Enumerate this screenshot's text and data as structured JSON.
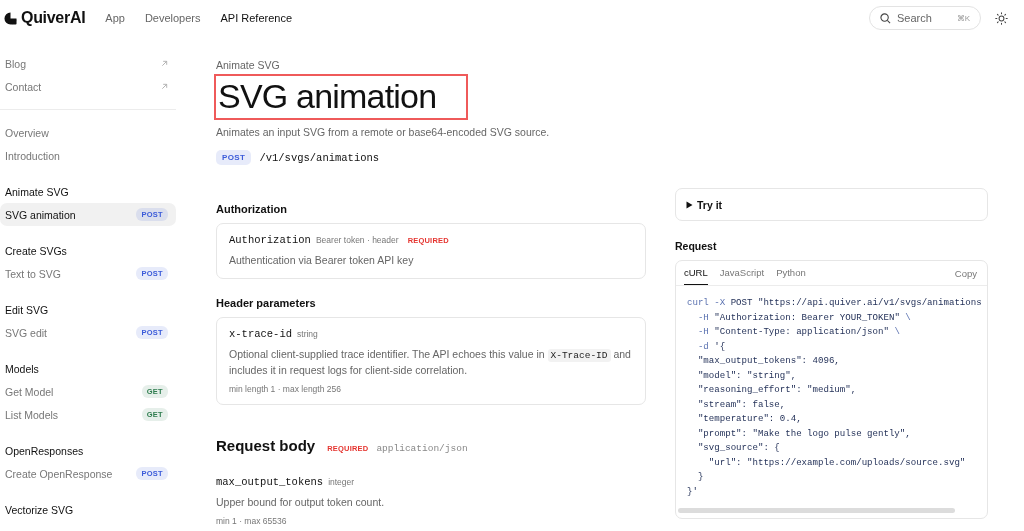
{
  "nav": {
    "brand": "QuiverAI",
    "links": [
      {
        "label": "App",
        "selected": false
      },
      {
        "label": "Developers",
        "selected": false
      },
      {
        "label": "API Reference",
        "selected": true
      }
    ],
    "search": {
      "placeholder": "Search",
      "shortcut": "⌘K"
    }
  },
  "sidebar": {
    "external_links": [
      {
        "label": "Blog"
      },
      {
        "label": "Contact"
      }
    ],
    "pages": [
      {
        "label": "Overview"
      },
      {
        "label": "Introduction"
      }
    ],
    "groups": [
      {
        "title": "Animate SVG",
        "items": [
          {
            "label": "SVG animation",
            "method": "POST",
            "color": "#3b5bd9",
            "selected": true
          }
        ]
      },
      {
        "title": "Create SVGs",
        "items": [
          {
            "label": "Text to SVG",
            "method": "POST",
            "color": "#3b5bd9",
            "selected": false
          }
        ]
      },
      {
        "title": "Edit SVG",
        "items": [
          {
            "label": "SVG edit",
            "method": "POST",
            "color": "#3b5bd9",
            "selected": false
          }
        ]
      },
      {
        "title": "Models",
        "items": [
          {
            "label": "Get Model",
            "method": "GET",
            "color": "#2f7d4f",
            "selected": false
          },
          {
            "label": "List Models",
            "method": "GET",
            "color": "#2f7d4f",
            "selected": false
          }
        ]
      },
      {
        "title": "OpenResponses",
        "items": [
          {
            "label": "Create OpenResponse",
            "method": "POST",
            "color": "#3b5bd9",
            "selected": false
          }
        ]
      },
      {
        "title": "Vectorize SVG"
      }
    ]
  },
  "main": {
    "breadcrumb": "Animate SVG",
    "title": "SVG animation",
    "title_highlighted": true,
    "description": "Animates an input SVG from a remote or base64-encoded SVG source.",
    "endpoint": {
      "method": "POST",
      "path": "/v1/svgs/animations"
    },
    "authorization": {
      "heading": "Authorization",
      "params": [
        {
          "name": "Authorization",
          "type": "Bearer token · header",
          "required_label": "REQUIRED",
          "description": [
            {
              "text": "Authentication via Bearer token API key",
              "kind": "text"
            }
          ]
        }
      ]
    },
    "header_parameters": {
      "heading": "Header parameters",
      "params": [
        {
          "name": "x-trace-id",
          "type": "string",
          "description": [
            {
              "text": "Optional client-supplied trace identifier. The API echoes this value in ",
              "kind": "text"
            },
            {
              "text": "X-Trace-ID",
              "kind": "code"
            },
            {
              "text": " and includes it in request logs for client-side correlation.",
              "kind": "text"
            }
          ],
          "constraints": "min length 1 · max length 256"
        }
      ]
    },
    "request_body": {
      "heading": "Request body",
      "required_label": "REQUIRED",
      "content_type": "application/json",
      "fields": [
        {
          "name": "max_output_tokens",
          "type": "integer",
          "description": "Upper bound for output token count.",
          "constraints": "min 1 · max 65536"
        }
      ]
    }
  },
  "side": {
    "try_it": {
      "label": "Try it",
      "expanded": false
    },
    "request": {
      "heading": "Request",
      "tabs": [
        {
          "label": "cURL",
          "selected": true
        },
        {
          "label": "JavaScript",
          "selected": false
        },
        {
          "label": "Python",
          "selected": false
        }
      ],
      "copy_label": "Copy",
      "code_lines": [
        [
          {
            "text": "curl -X",
            "kind": "flag"
          },
          {
            "text": " POST \"https://api.quiver.ai/v1/svgs/animations",
            "kind": "text"
          }
        ],
        [
          {
            "text": "  -H",
            "kind": "flag"
          },
          {
            "text": " \"Authorization: Bearer YOUR_TOKEN\" ",
            "kind": "text"
          },
          {
            "text": "\\",
            "kind": "flag"
          }
        ],
        [
          {
            "text": "  -H",
            "kind": "flag"
          },
          {
            "text": " \"Content-Type: application/json\" ",
            "kind": "text"
          },
          {
            "text": "\\",
            "kind": "flag"
          }
        ],
        [
          {
            "text": "  -d",
            "kind": "flag"
          },
          {
            "text": " '{",
            "kind": "text"
          }
        ],
        [
          {
            "text": "  \"max_output_tokens\": 4096,",
            "kind": "text"
          }
        ],
        [
          {
            "text": "  \"model\": \"string\",",
            "kind": "text"
          }
        ],
        [
          {
            "text": "  \"reasoning_effort\": \"medium\",",
            "kind": "text"
          }
        ],
        [
          {
            "text": "  \"stream\": false,",
            "kind": "text"
          }
        ],
        [
          {
            "text": "  \"temperature\": 0.4,",
            "kind": "text"
          }
        ],
        [
          {
            "text": "  \"prompt\": \"Make the logo pulse gently\",",
            "kind": "text"
          }
        ],
        [
          {
            "text": "  \"svg_source\": {",
            "kind": "text"
          }
        ],
        [
          {
            "text": "    \"url\": \"https://example.com/uploads/source.svg\"",
            "kind": "text"
          }
        ],
        [
          {
            "text": "  }",
            "kind": "text"
          }
        ],
        [
          {
            "text": "}'",
            "kind": "text"
          }
        ]
      ]
    }
  }
}
